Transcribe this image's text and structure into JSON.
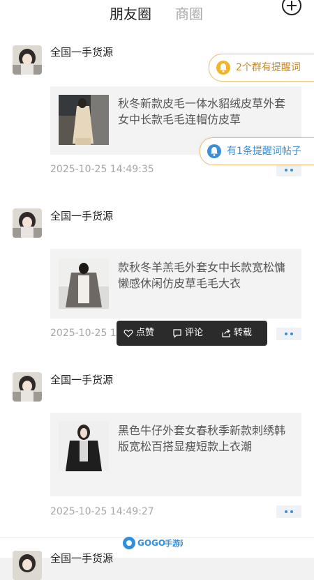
{
  "header": {
    "tab_active": "朋友圈",
    "tab_inactive": "商圈",
    "add_icon": "plus-circle-icon"
  },
  "pills": {
    "group_reminder": "2个群有提醒词",
    "post_reminder": "有1条提醒词帖子"
  },
  "posts": [
    {
      "author": "全国一手货源",
      "content": "秋冬新款皮毛一体水貂绒皮草外套女中长款毛毛连帽仿皮草",
      "time": "2025-10-25 14:49:35"
    },
    {
      "author": "全国一手货源",
      "content": "款秋冬羊羔毛外套女中长款宽松慵懒感休闲仿皮草毛毛大衣",
      "time": "2025-10-25 14"
    },
    {
      "author": "全国一手货源",
      "content": "黑色牛仔外套女春秋季新款刺绣韩版宽松百搭显瘦短款上衣潮",
      "time": "2025-10-25 14:49:27"
    },
    {
      "author": "全国一手货源"
    }
  ],
  "popup": {
    "like": "点赞",
    "comment": "评论",
    "share": "转载"
  },
  "watermark": {
    "brand": "GOGO手游网",
    "url": "www.gogo.cn"
  },
  "colors": {
    "accent": "#f6b226",
    "blue": "#3a8fd6",
    "pill_border": "#e6c27c"
  }
}
